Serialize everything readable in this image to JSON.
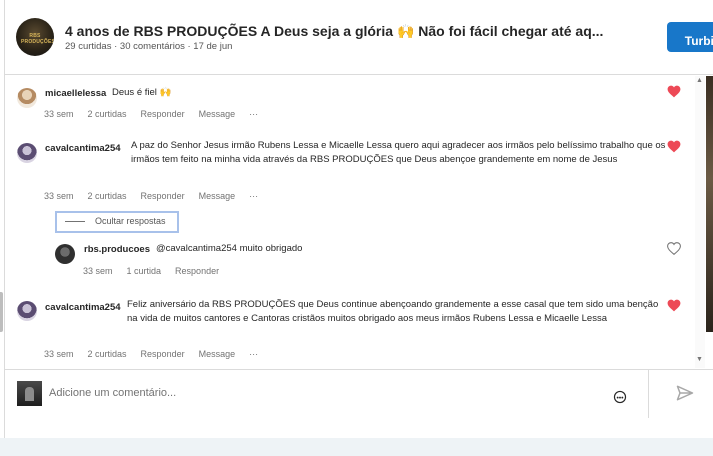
{
  "header": {
    "title": "4 anos de RBS PRODUÇÕES A Deus seja a glória 🙌 Não foi fácil chegar até aq...",
    "meta": "29 curtidas · 30 comentários · 17 de jun",
    "avatar_logo_text": "RBS PRODUÇÕES",
    "boost_label": "Turbin"
  },
  "comments": [
    {
      "username": "micaellelessa",
      "text": "Deus é fiel 🙌",
      "time": "33 sem",
      "likes": "2 curtidas",
      "reply": "Responder",
      "message": "Message",
      "more": "···",
      "liked": true
    },
    {
      "username": "cavalcantima254",
      "text": "A paz do Senhor Jesus irmão Rubens Lessa e Micaelle Lessa quero aqui agradecer aos irmãos pelo belíssimo trabalho que os irmãos tem feito na minha vida através da RBS PRODUÇÕES que Deus abençoe grandemente em nome de Jesus",
      "time": "33 sem",
      "likes": "2 curtidas",
      "reply": "Responder",
      "message": "Message",
      "more": "···",
      "liked": true
    },
    {
      "username": "cavalcantima254",
      "text": "Feliz aniversário da RBS PRODUÇÕES que Deus continue abençoando grandemente a esse casal que tem sido uma benção na vida de muitos cantores e Cantoras cristãos muitos obrigado aos meus irmãos Rubens Lessa e Micaelle Lessa",
      "time": "33 sem",
      "likes": "2 curtidas",
      "reply": "Responder",
      "message": "Message",
      "more": "···",
      "liked": true
    }
  ],
  "hide_replies_label": "Ocultar respostas",
  "reply": {
    "username": "rbs.producoes",
    "text": "@cavalcantima254 muito obrigado",
    "time": "33 sem",
    "likes": "1 curtida",
    "reply": "Responder",
    "liked": false
  },
  "footer": {
    "placeholder": "Adicione um comentário..."
  },
  "icons": {
    "heart_filled": "heart-filled-icon",
    "heart_outline": "heart-outline-icon",
    "emoji": "emoji-icon",
    "send": "send-icon"
  },
  "colors": {
    "accent": "#1877c9",
    "like_red": "#ed4956",
    "focus_border": "#a8c1ea"
  }
}
